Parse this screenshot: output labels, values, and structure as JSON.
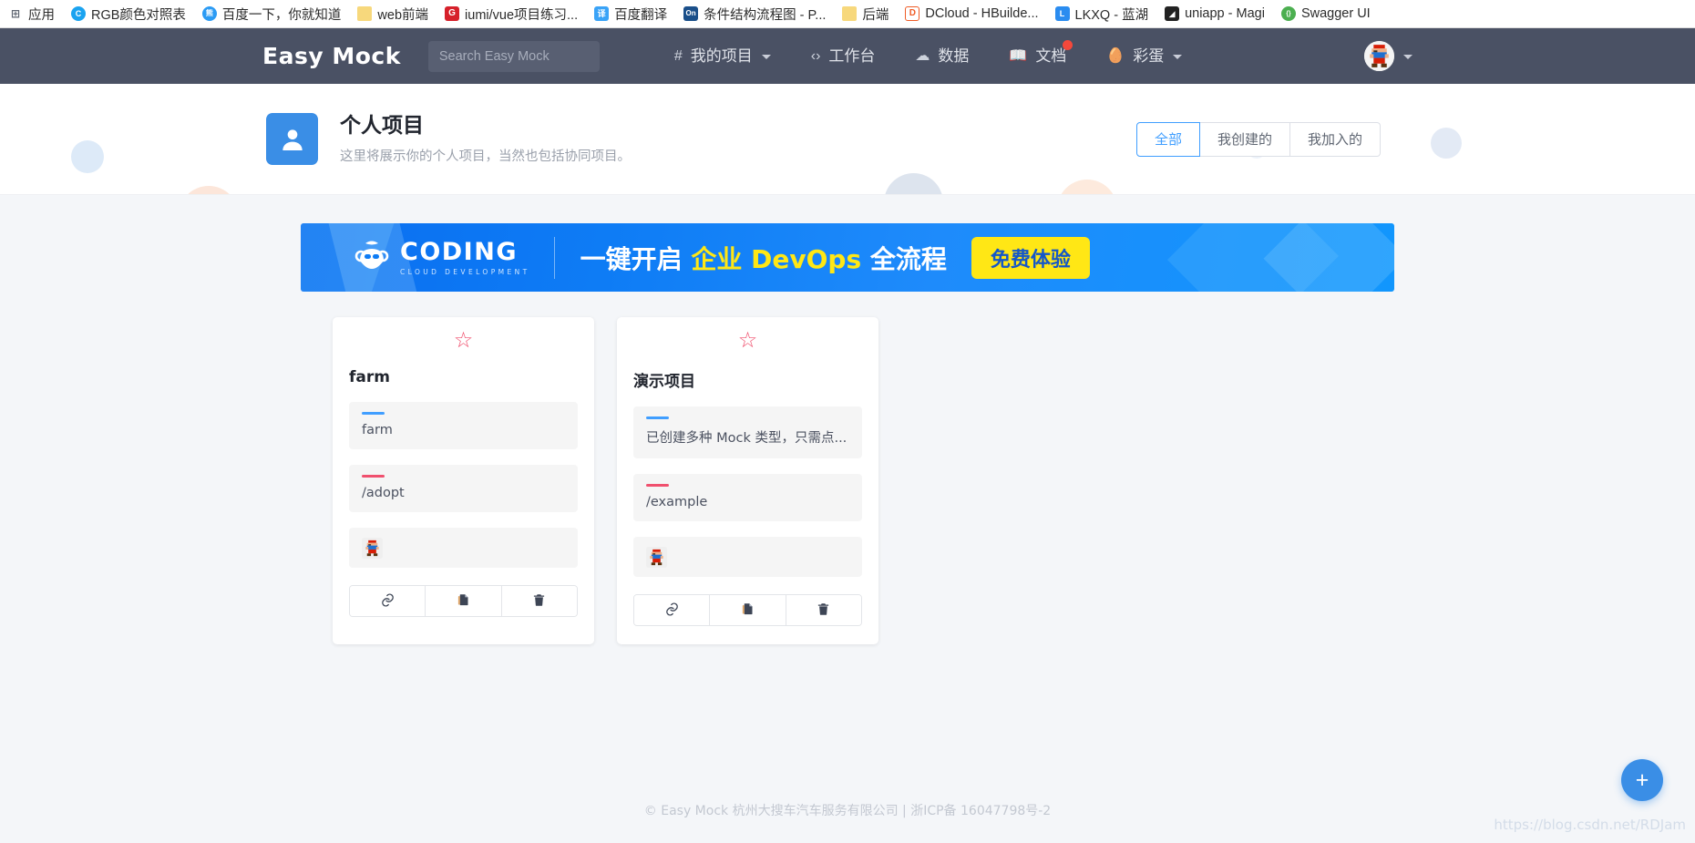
{
  "browser": {
    "bookmarks": [
      {
        "label": "应用",
        "icon": "apps-icon",
        "color": "#ffffff"
      },
      {
        "label": "RGB颜色对照表",
        "icon": "crescent-icon",
        "color": "#1aa3f0"
      },
      {
        "label": "百度一下，你就知道",
        "icon": "baidu-paw-icon",
        "color": "#2b9bf4"
      },
      {
        "label": "web前端",
        "icon": "folder-icon",
        "color": "#f7d87c"
      },
      {
        "label": "iumi/vue项目练习...",
        "icon": "gitee-icon",
        "color": "#d6202a"
      },
      {
        "label": "百度翻译",
        "icon": "fanyi-icon",
        "color": "#3aa3f7"
      },
      {
        "label": "条件结构流程图 - P...",
        "icon": "onenote-icon",
        "color": "#1a4f8a"
      },
      {
        "label": "后端",
        "icon": "folder-icon",
        "color": "#f7d87c"
      },
      {
        "label": "DCloud - HBuilde...",
        "icon": "dcloud-icon",
        "color": "#ef5b25"
      },
      {
        "label": "LKXQ - 蓝湖",
        "icon": "lanhu-icon",
        "color": "#2a8cf0"
      },
      {
        "label": "uniapp - Magi",
        "icon": "magi-icon",
        "color": "#222222"
      },
      {
        "label": "Swagger UI",
        "icon": "swagger-icon",
        "color": "#4caf50"
      }
    ]
  },
  "nav": {
    "brand": "Easy Mock",
    "search_placeholder": "Search Easy Mock",
    "search_value": "",
    "items": [
      {
        "label": "我的项目",
        "icon": "hash-icon",
        "glyph": "#",
        "caret": true,
        "badge": false
      },
      {
        "label": "工作台",
        "icon": "code-brackets-icon",
        "glyph": "‹›",
        "caret": false,
        "badge": false
      },
      {
        "label": "数据",
        "icon": "cloud-icon",
        "glyph": "☁",
        "caret": false,
        "badge": false
      },
      {
        "label": "文档",
        "icon": "book-icon",
        "glyph": "📖",
        "caret": false,
        "badge": true
      },
      {
        "label": "彩蛋",
        "icon": "egg-icon",
        "glyph": "🥚",
        "caret": true,
        "badge": false
      }
    ],
    "user_avatar": "mario-avatar-icon"
  },
  "header": {
    "avatar_icon": "user-silhouette-icon",
    "title": "个人项目",
    "subtitle": "这里将展示你的个人项目，当然也包括协同项目。",
    "filters": [
      {
        "label": "全部",
        "active": true
      },
      {
        "label": "我创建的",
        "active": false
      },
      {
        "label": "我加入的",
        "active": false
      }
    ]
  },
  "banner": {
    "logo_word": "CODING",
    "logo_sub": "CLOUD DEVELOPMENT",
    "text_plain_1": "一键开启 ",
    "text_highlight": "企业 DevOps",
    "text_plain_2": " 全流程",
    "cta_label": "免费体验"
  },
  "projects": [
    {
      "starred": false,
      "star_icon": "star-outline-icon",
      "name": "farm",
      "description": "farm",
      "base_url": "/adopt",
      "member_avatar": "mario-avatar-icon",
      "actions": [
        {
          "name": "copy-link-button",
          "icon": "link-icon",
          "glyph": "🔗"
        },
        {
          "name": "clone-project-button",
          "icon": "copy-document-icon",
          "glyph": "📄"
        },
        {
          "name": "delete-project-button",
          "icon": "trash-icon",
          "glyph": "🗑"
        }
      ]
    },
    {
      "starred": false,
      "star_icon": "star-outline-icon",
      "name": "演示项目",
      "description": "已创建多种 Mock 类型，只需点...",
      "base_url": "/example",
      "member_avatar": "mario-avatar-icon",
      "actions": [
        {
          "name": "copy-link-button",
          "icon": "link-icon",
          "glyph": "🔗"
        },
        {
          "name": "clone-project-button",
          "icon": "copy-document-icon",
          "glyph": "📄"
        },
        {
          "name": "delete-project-button",
          "icon": "trash-icon",
          "glyph": "🗑"
        }
      ]
    }
  ],
  "fab": {
    "label": "+",
    "icon": "plus-icon"
  },
  "footer": {
    "text": "© Easy Mock 杭州大搜车汽车服务有限公司 | 浙ICP备 16047798号-2"
  },
  "watermark": {
    "text": "https://blog.csdn.net/RDJam"
  },
  "colors": {
    "nav_bg": "#4a5164",
    "accent_blue": "#409eff",
    "accent_red": "#f0506e",
    "banner_blue": "#0e7cf5",
    "banner_yellow": "#ffe715"
  }
}
